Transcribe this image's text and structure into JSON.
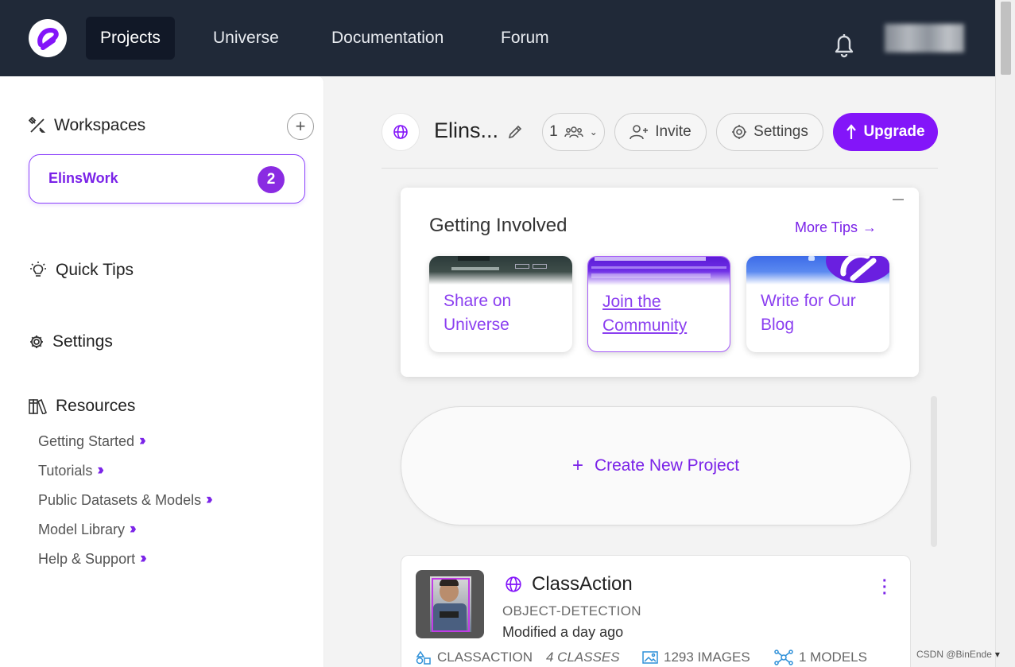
{
  "topnav": {
    "items": [
      "Projects",
      "Universe",
      "Documentation",
      "Forum"
    ],
    "active": "Projects"
  },
  "sidebar": {
    "workspaces_label": "Workspaces",
    "workspace": {
      "name": "ElinsWork",
      "badge": "2"
    },
    "quick_tips_label": "Quick Tips",
    "settings_label": "Settings",
    "resources_label": "Resources",
    "resources": [
      "Getting Started",
      "Tutorials",
      "Public Datasets & Models",
      "Model Library",
      "Help & Support"
    ]
  },
  "header": {
    "title": "Elins...",
    "members_count": "1",
    "invite_label": "Invite",
    "settings_label": "Settings",
    "upgrade_label": "Upgrade"
  },
  "getting_involved": {
    "title": "Getting Involved",
    "more_tips_label": "More Tips",
    "tips": [
      {
        "label_line1": "Share on",
        "label_line2": "Universe"
      },
      {
        "label_line1": "Join the",
        "label_line2": "Community"
      },
      {
        "label_line1": "Write for Our",
        "label_line2": "Blog"
      }
    ]
  },
  "create_project_label": "Create New Project",
  "project": {
    "name": "ClassAction",
    "type": "OBJECT-DETECTION",
    "modified": "Modified a day ago",
    "class_name": "CLASSACTION",
    "classes": "4 CLASSES",
    "images": "1293 IMAGES",
    "models": "1 MODELS"
  },
  "watermark": "CSDN @BinEnde",
  "colors": {
    "accent": "#8315f9",
    "nav_bg": "#202938",
    "link": "#7a22e8"
  }
}
